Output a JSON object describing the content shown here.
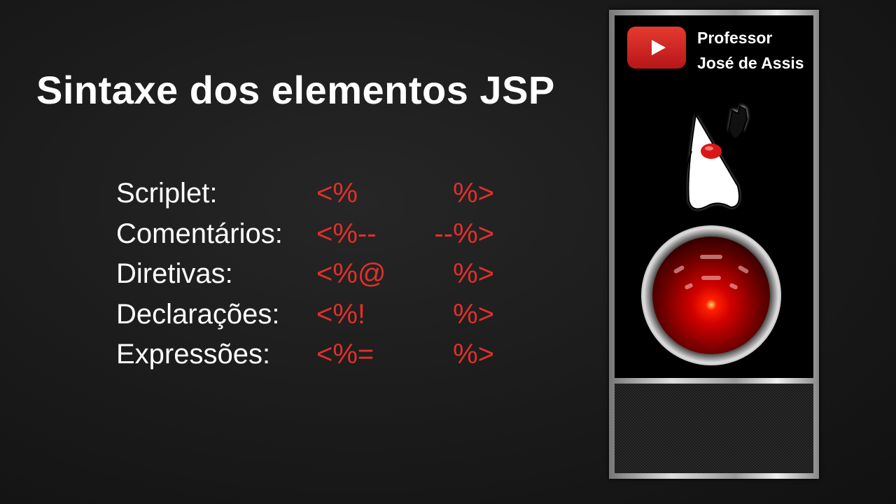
{
  "slide": {
    "title": "Sintaxe dos elementos JSP",
    "rows": [
      {
        "label": "Scriplet:",
        "open": "<%",
        "close": "%>"
      },
      {
        "label": "Comentários:",
        "open": "<%--",
        "close": "--%>"
      },
      {
        "label": "Diretivas:",
        "open": "<%@",
        "close": "%>"
      },
      {
        "label": "Declarações:",
        "open": "<%!",
        "close": "%>"
      },
      {
        "label": "Expressões:",
        "open": "<%=",
        "close": "%>"
      }
    ],
    "colors": {
      "text": "#ffffff",
      "tag": "#e0302a",
      "background": "#1a1a1a"
    }
  },
  "panel": {
    "channel_line1": "Professor",
    "channel_line2": "José de Assis",
    "icons": [
      "youtube-icon",
      "java-duke-mascot",
      "hal-9000-eye"
    ]
  }
}
